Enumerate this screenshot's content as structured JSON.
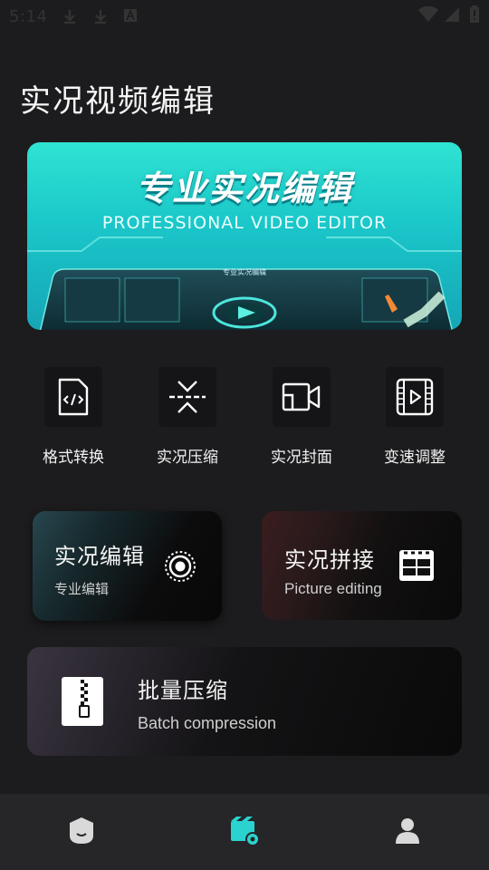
{
  "status_bar": {
    "time": "5:14"
  },
  "page": {
    "title": "实况视频编辑"
  },
  "banner": {
    "title": "专业实况编辑",
    "subtitle": "PROFESSIONAL VIDEO EDITOR",
    "screen_label": "专业实况编辑"
  },
  "tools": [
    {
      "label": "格式转换",
      "icon": "code-file-icon"
    },
    {
      "label": "实况压缩",
      "icon": "compress-icon"
    },
    {
      "label": "实况封面",
      "icon": "video-camera-icon"
    },
    {
      "label": "变速调整",
      "icon": "film-play-icon"
    }
  ],
  "cards": {
    "live_edit": {
      "title": "实况编辑",
      "subtitle": "专业编辑"
    },
    "live_stitch": {
      "title": "实况拼接",
      "subtitle": "Picture editing"
    },
    "batch": {
      "title": "批量压缩",
      "subtitle": "Batch compression"
    }
  },
  "nav": {
    "active": "edit",
    "accent": "#2bd3d0"
  }
}
